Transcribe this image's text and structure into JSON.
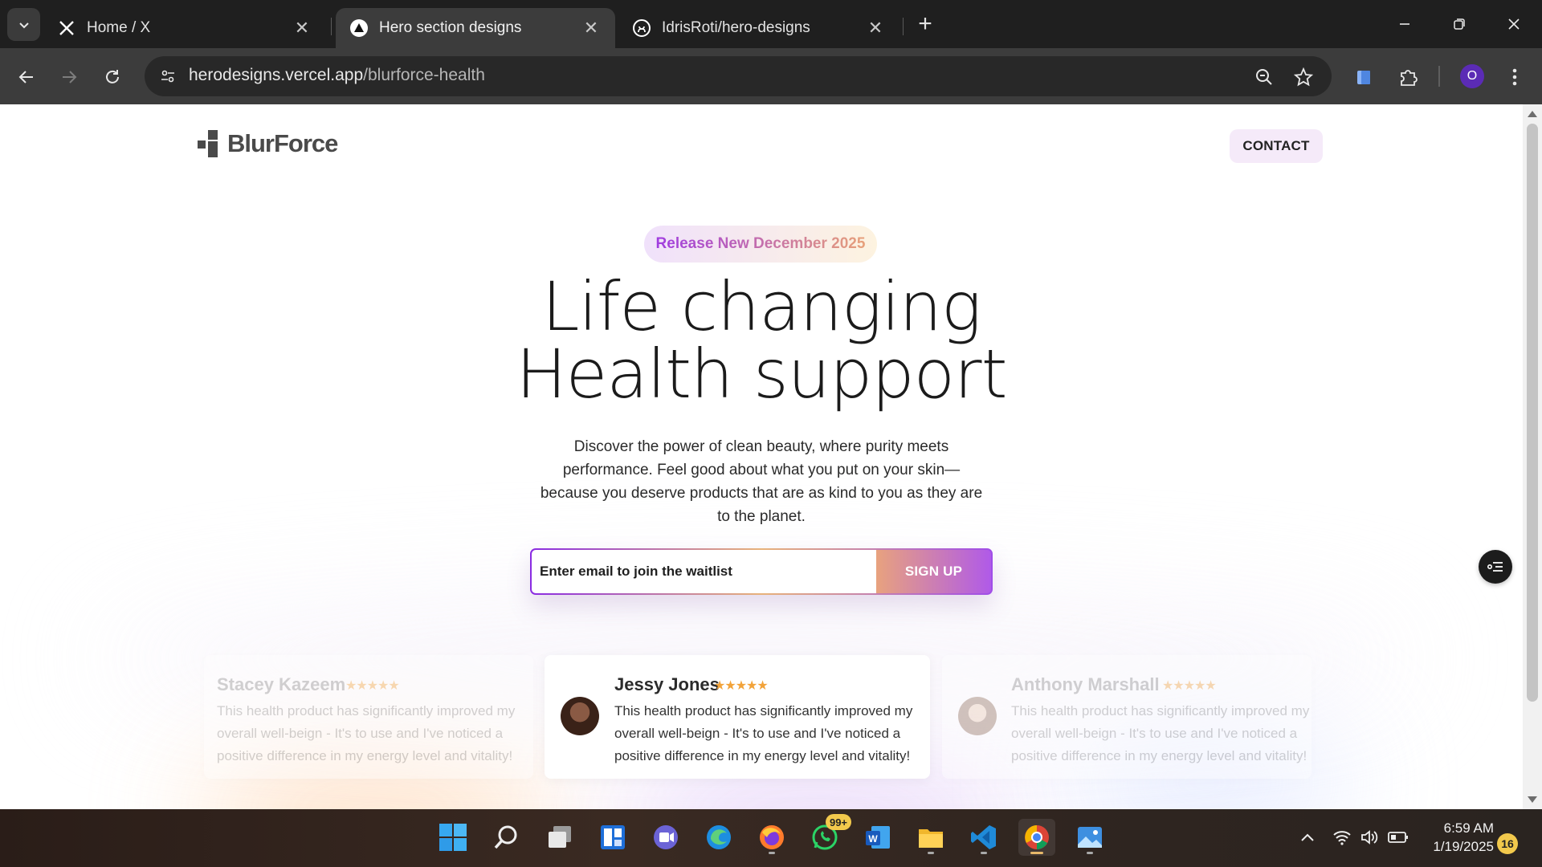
{
  "browser": {
    "tabs": [
      {
        "title": "Home / X",
        "favicon": "x-logo-icon",
        "active": false
      },
      {
        "title": "Hero section designs",
        "favicon": "triangle-logo-icon",
        "active": true
      },
      {
        "title": "IdrisRoti/hero-designs",
        "favicon": "github-icon",
        "active": false
      }
    ],
    "url_host": "herodesigns.vercel.app",
    "url_path": "/blurforce-health",
    "profile_initial": "O"
  },
  "page": {
    "logo_text": "BlurForce",
    "contact_label": "CONTACT",
    "badge_text": "Release New December 2025",
    "headline_line1": "Life changing",
    "headline_line2": "Health support",
    "description": "Discover the power of clean beauty, where purity meets performance. Feel good about what you put on your skin—because you deserve products that are as kind to you as they are to the planet.",
    "email_placeholder": "Enter email to join the waitlist",
    "signup_label": "SIGN UP",
    "testimonials": [
      {
        "name": "Stacey Kazeem",
        "stars": "★★★★★",
        "quote": "This health product has significantly improved my overall well-beign - It's to use and I've noticed a positive difference in my energy level and vitality!"
      },
      {
        "name": "Jessy Jones",
        "stars": "★★★★★",
        "quote": "This health product has significantly improved my overall well-beign - It's to use and I've noticed a positive difference in my energy level and vitality!"
      },
      {
        "name": "Anthony Marshall",
        "stars": "★★★★★",
        "quote": "This health product has significantly improved my overall well-beign - It's to use and I've noticed a positive difference in my energy level and vitality!"
      }
    ],
    "rating": 5,
    "colors": {
      "accent_purple": "#8a2be2",
      "accent_peach": "#e8a27e",
      "star": "#f2a33a"
    }
  },
  "taskbar": {
    "apps": [
      "windows-start-icon",
      "search-icon",
      "task-view-icon",
      "widgets-icon",
      "teams-icon",
      "edge-icon",
      "firefox-icon",
      "whatsapp-icon",
      "word-icon",
      "file-explorer-icon",
      "vscode-icon",
      "chrome-icon",
      "photos-icon"
    ],
    "whatsapp_badge": "99+",
    "time": "6:59 AM",
    "date": "1/19/2025",
    "notification_count": "16"
  }
}
